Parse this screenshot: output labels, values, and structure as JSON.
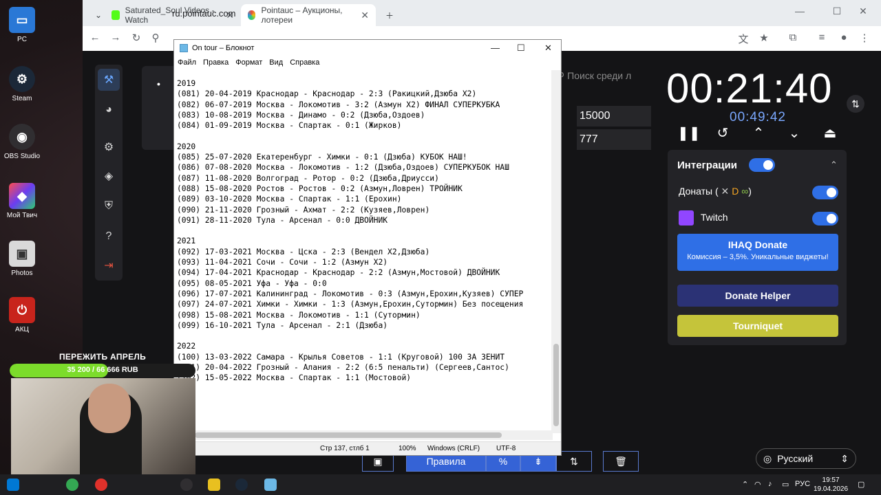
{
  "desktop": {
    "icons": [
      {
        "label": "PC"
      },
      {
        "label": "Steam"
      },
      {
        "label": "OBS Studio"
      },
      {
        "label": "Мой Твич"
      },
      {
        "label": "Photos"
      },
      {
        "label": "АКЦ"
      }
    ]
  },
  "browser": {
    "tabs": [
      {
        "label": "Saturated_Soul Videos - Watch"
      },
      {
        "label": "Pointauc – Аукционы, лотереи"
      }
    ],
    "url": "ru.pointauc.com"
  },
  "site": {
    "search_placeholder": "Поиск среди л",
    "lots": [
      {
        "value": "15000"
      },
      {
        "value": "777"
      }
    ],
    "timer": "00:21:40",
    "subtimer": "00:49:42",
    "integrations": {
      "title": "Интеграции",
      "donations_label": "Донаты (",
      "donations_close": ")",
      "twitch_label": "Twitch",
      "ihaq_title": "IHAQ Donate",
      "ihaq_subtitle": "Комиссия – 3,5%. Уникальные виджеты!",
      "donatehelper": "Donate Helper",
      "tourniquet": "Tourniquet"
    },
    "language": "Русский",
    "rules_button": "Правила",
    "percent_button": "%"
  },
  "notepad": {
    "title": "On tour – Блокнот",
    "menu": [
      "Файл",
      "Правка",
      "Формат",
      "Вид",
      "Справка"
    ],
    "lines": [
      "2019",
      "(081) 20-04-2019 Краснодар - Краснодар - 2:3 (Ракицкий,Дзюба X2)",
      "(082) 06-07-2019 Москва - Локомотив - 3:2 (Азмун X2) ФИНАЛ СУПЕРКУБКА",
      "(083) 10-08-2019 Москва - Динамо - 0:2 (Дзюба,Оздоев)",
      "(084) 01-09-2019 Москва - Спартак - 0:1 (Жирков)",
      "",
      "2020",
      "(085) 25-07-2020 Екатеренбург - Химки - 0:1 (Дзюба) КУБОК НАШ!",
      "(086) 07-08-2020 Москва - Локомотив - 1:2 (Дзюба,Оздоев) СУПЕРКУБОК НАШ",
      "(087) 11-08-2020 Волгоград - Ротор - 0:2 (Дзюба,Дриусси)",
      "(088) 15-08-2020 Ростов - Ростов - 0:2 (Азмун,Ловрен) ТРОЙНИК",
      "(089) 03-10-2020 Москва - Спартак - 1:1 (Ерохин)",
      "(090) 21-11-2020 Грозный - Ахмат - 2:2 (Кузяев,Ловрен)",
      "(091) 28-11-2020 Тула - Арсенал - 0:0 ДВОЙНИК",
      "",
      "2021",
      "(092) 17-03-2021 Москва - Цска - 2:3 (Вендел X2,Дзюба)",
      "(093) 11-04-2021 Сочи - Сочи - 1:2 (Азмун X2)",
      "(094) 17-04-2021 Краснодар - Краснодар - 2:2 (Азмун,Мостовой) ДВОЙНИК",
      "(095) 08-05-2021 Уфа - Уфа - 0:0",
      "(096) 17-07-2021 Калининград - Локомотив - 0:3 (Азмун,Ерохин,Кузяев) СУПЕР",
      "(097) 24-07-2021 Химки - Химки - 1:3 (Азмун,Ерохин,Сутормин) Без посещения",
      "(098) 15-08-2021 Москва - Локомотив - 1:1 (Сутормин)",
      "(099) 16-10-2021 Тула - Арсенал - 2:1 (Дзюба)",
      "",
      "2022",
      "(100) 13-03-2022 Самара - Крылья Советов - 1:1 (Круговой) 100 ЗА ЗЕНИТ",
      "(101) 20-04-2022 Грозный - Алания - 2:2 (6:5 пенальти) (Сергеев,Сантос)",
      "(102) 15-05-2022 Москва - Спартак - 1:1 (Мостовой)"
    ],
    "status": {
      "position": "Стр 137, стлб 1",
      "zoom": "100%",
      "line_endings": "Windows (CRLF)",
      "encoding": "UTF-8"
    }
  },
  "overlay": {
    "goal_title": "ПЕРЕЖИТЬ АПРЕЛЬ",
    "goal_progress": "35 200 / 66 666 RUB",
    "goal_fraction": 0.528
  },
  "taskbar": {
    "lang": "РУС",
    "time": "19:57",
    "date": "19.04.2026"
  },
  "colors": {
    "accent": "#3563d6",
    "goal_fill": "#7cdc2b",
    "tourniquet": "#c5c43a"
  }
}
